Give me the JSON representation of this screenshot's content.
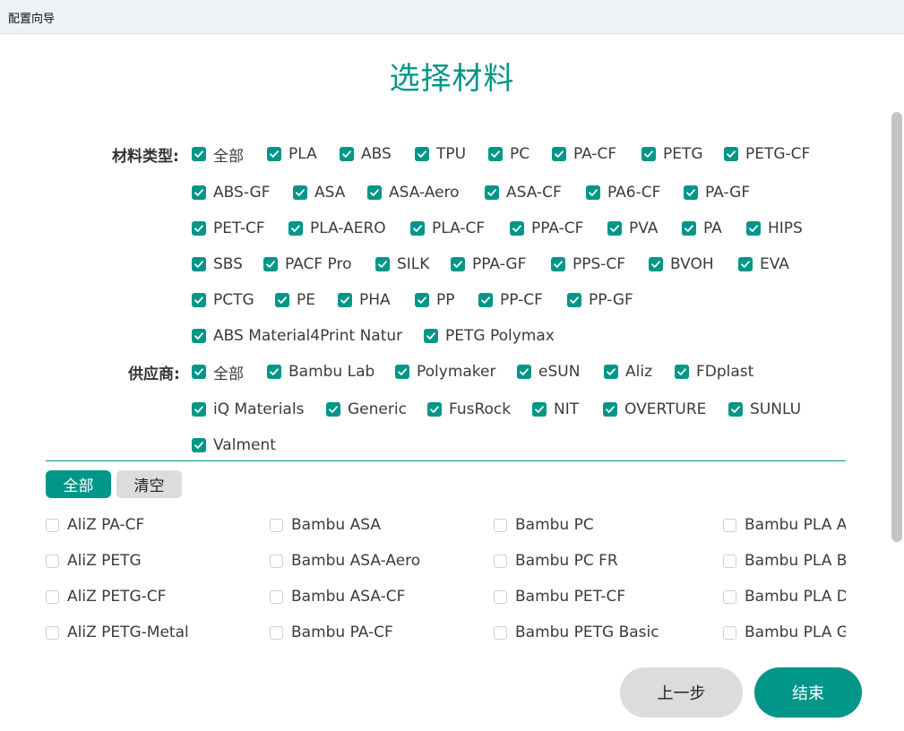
{
  "window": {
    "title": "配置向导"
  },
  "page": {
    "title": "选择材料"
  },
  "filters": {
    "type_label": "材料类型:",
    "types": [
      "全部",
      "PLA",
      "ABS",
      "TPU",
      "PC",
      "PA-CF",
      "PETG",
      "PETG-CF",
      "ABS-GF",
      "ASA",
      "ASA-Aero",
      "ASA-CF",
      "PA6-CF",
      "PA-GF",
      "PET-CF",
      "PLA-AERO",
      "PLA-CF",
      "PPA-CF",
      "PVA",
      "PA",
      "HIPS",
      "SBS",
      "PACF Pro",
      "SILK",
      "PPA-GF",
      "PPS-CF",
      "BVOH",
      "EVA",
      "PCTG",
      "PE",
      "PHA",
      "PP",
      "PP-CF",
      "PP-GF",
      "ABS Material4Print Natur",
      "PETG Polymax"
    ],
    "vendor_label": "供应商:",
    "vendors": [
      "全部",
      "Bambu Lab",
      "Polymaker",
      "eSUN",
      "Aliz",
      "FDplast",
      "iQ Materials",
      "Generic",
      "FusRock",
      "NIT",
      "OVERTURE",
      "SUNLU",
      "Valment"
    ]
  },
  "actions": {
    "select_all": "全部",
    "clear": "清空"
  },
  "materials": [
    "AliZ PA-CF",
    "Bambu ASA",
    "Bambu PC",
    "Bambu PLA A",
    "AliZ PETG",
    "Bambu ASA-Aero",
    "Bambu PC FR",
    "Bambu PLA B",
    "AliZ PETG-CF",
    "Bambu ASA-CF",
    "Bambu PET-CF",
    "Bambu PLA D",
    "AliZ PETG-Metal",
    "Bambu PA-CF",
    "Bambu PETG Basic",
    "Bambu PLA G"
  ],
  "footer": {
    "prev": "上一步",
    "finish": "结束"
  },
  "colors": {
    "accent": "#009688"
  }
}
